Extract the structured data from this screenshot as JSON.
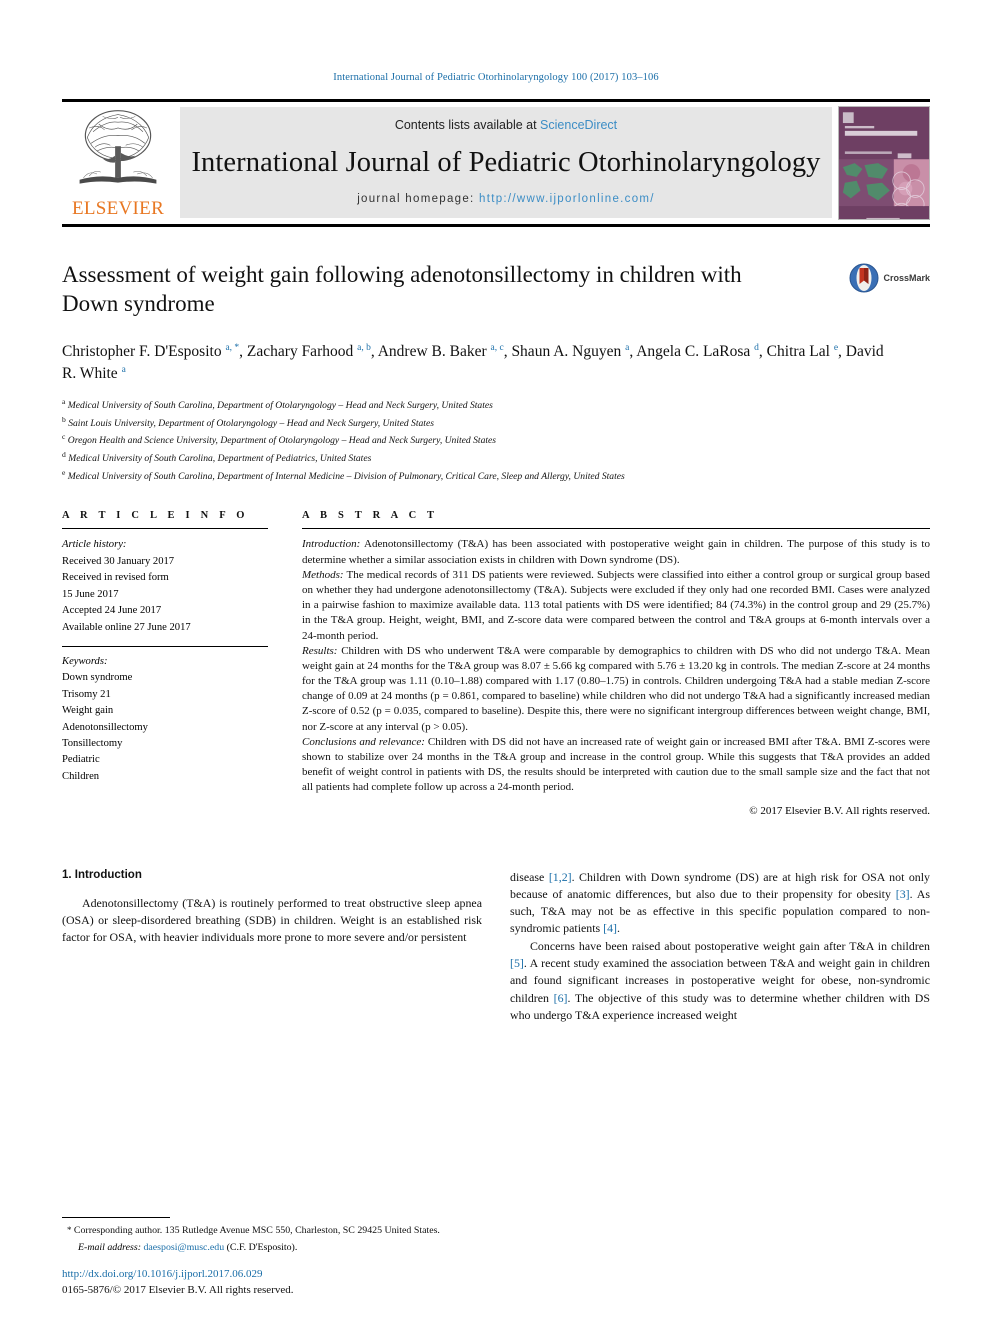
{
  "running_head": "International Journal of Pediatric Otorhinolaryngology 100 (2017) 103–106",
  "masthead": {
    "contents_prefix": "Contents lists available at ",
    "sciencedirect": "ScienceDirect",
    "journal_title": "International Journal of Pediatric Otorhinolaryngology",
    "homepage_prefix": "journal homepage: ",
    "homepage_url": "http://www.ijporlonline.com/",
    "publisher_name": "ELSEVIER",
    "publisher_logo_icon": "elsevier-tree-icon",
    "cover_icon": "journal-cover-thumbnail"
  },
  "crossmark": {
    "label": "CrossMark",
    "icon": "crossmark-badge-icon"
  },
  "article": {
    "title": "Assessment of weight gain following adenotonsillectomy in children with Down syndrome",
    "authors_html": "Christopher F. D'Esposito <sup>a, *</sup>, Zachary Farhood <sup>a, b</sup>, Andrew B. Baker <sup>a, c</sup>, Shaun A. Nguyen <sup>a</sup>, Angela C. LaRosa <sup>d</sup>, Chitra Lal <sup>e</sup>, David R. White <sup>a</sup>",
    "affiliations": [
      {
        "marker": "a",
        "text": "Medical University of South Carolina, Department of Otolaryngology – Head and Neck Surgery, United States"
      },
      {
        "marker": "b",
        "text": "Saint Louis University, Department of Otolaryngology – Head and Neck Surgery, United States"
      },
      {
        "marker": "c",
        "text": "Oregon Health and Science University, Department of Otolaryngology – Head and Neck Surgery, United States"
      },
      {
        "marker": "d",
        "text": "Medical University of South Carolina, Department of Pediatrics, United States"
      },
      {
        "marker": "e",
        "text": "Medical University of South Carolina, Department of Internal Medicine – Division of Pulmonary, Critical Care, Sleep and Allergy, United States"
      }
    ]
  },
  "article_info": {
    "heading": "A R T I C L E   I N F O",
    "history_label": "Article history:",
    "history": [
      "Received 30 January 2017",
      "Received in revised form",
      "15 June 2017",
      "Accepted 24 June 2017",
      "Available online 27 June 2017"
    ],
    "keywords_label": "Keywords:",
    "keywords": [
      "Down syndrome",
      "Trisomy 21",
      "Weight gain",
      "Adenotonsillectomy",
      "Tonsillectomy",
      "Pediatric",
      "Children"
    ]
  },
  "abstract": {
    "heading": "A B S T R A C T",
    "introduction_label": "Introduction:",
    "introduction_text": " Adenotonsillectomy (T&A) has been associated with postoperative weight gain in children. The purpose of this study is to determine whether a similar association exists in children with Down syndrome (DS).",
    "methods_label": "Methods:",
    "methods_text": " The medical records of 311 DS patients were reviewed. Subjects were classified into either a control group or surgical group based on whether they had undergone adenotonsillectomy (T&A). Subjects were excluded if they only had one recorded BMI. Cases were analyzed in a pairwise fashion to maximize available data. 113 total patients with DS were identified; 84 (74.3%) in the control group and 29 (25.7%) in the T&A group. Height, weight, BMI, and Z-score data were compared between the control and T&A groups at 6-month intervals over a 24-month period.",
    "results_label": "Results:",
    "results_text": " Children with DS who underwent T&A were comparable by demographics to children with DS who did not undergo T&A. Mean weight gain at 24 months for the T&A group was 8.07 ± 5.66 kg compared with 5.76 ± 13.20 kg in controls. The median Z-score at 24 months for the T&A group was 1.11 (0.10–1.88) compared with 1.17 (0.80–1.75) in controls. Children undergoing T&A had a stable median Z-score change of 0.09 at 24 months (p = 0.861, compared to baseline) while children who did not undergo T&A had a significantly increased median Z-score of 0.52 (p = 0.035, compared to baseline). Despite this, there were no significant intergroup differences between weight change, BMI, nor Z-score at any interval (p > 0.05).",
    "conclusions_label": "Conclusions and relevance:",
    "conclusions_text": " Children with DS did not have an increased rate of weight gain or increased BMI after T&A. BMI Z-scores were shown to stabilize over 24 months in the T&A group and increase in the control group. While this suggests that T&A provides an added benefit of weight control in patients with DS, the results should be interpreted with caution due to the small sample size and the fact that not all patients had complete follow up across a 24-month period.",
    "copyright": "© 2017 Elsevier B.V. All rights reserved."
  },
  "body": {
    "section_number_title": "1. Introduction",
    "left_paragraph": "Adenotonsillectomy (T&A) is routinely performed to treat obstructive sleep apnea (OSA) or sleep-disordered breathing (SDB) in children. Weight is an established risk factor for OSA, with heavier individuals more prone to more severe and/or persistent",
    "right_paragraph_1_pre": "disease ",
    "right_paragraph_1_ref1": "[1,2]",
    "right_paragraph_1_mid1": ". Children with Down syndrome (DS) are at high risk for OSA not only because of anatomic differences, but also due to their propensity for obesity ",
    "right_paragraph_1_ref2": "[3]",
    "right_paragraph_1_mid2": ". As such, T&A may not be as effective in this specific population compared to non-syndromic patients ",
    "right_paragraph_1_ref3": "[4]",
    "right_paragraph_1_end": ".",
    "right_paragraph_2_pre": "Concerns have been raised about postoperative weight gain after T&A in children ",
    "right_paragraph_2_ref1": "[5]",
    "right_paragraph_2_mid1": ". A recent study examined the association between T&A and weight gain in children and found significant increases in postoperative weight for obese, non-syndromic children ",
    "right_paragraph_2_ref2": "[6]",
    "right_paragraph_2_end": ". The objective of this study was to determine whether children with DS who undergo T&A experience increased weight"
  },
  "footnote": {
    "star": "*",
    "corresponding": " Corresponding author. 135 Rutledge Avenue MSC 550, Charleston, SC 29425 United States.",
    "email_label": "E-mail address:",
    "email": "daesposi@musc.edu",
    "email_suffix": " (C.F. D'Esposito)."
  },
  "doi": {
    "url": "http://dx.doi.org/10.1016/j.ijporl.2017.06.029",
    "issn_line": "0165-5876/© 2017 Elsevier B.V. All rights reserved."
  },
  "colors": {
    "link_blue": "#1a6ea8",
    "elsevier_orange": "#e87722",
    "masthead_gray": "#e6e6e6",
    "cover_purple": "#6e3f63"
  }
}
